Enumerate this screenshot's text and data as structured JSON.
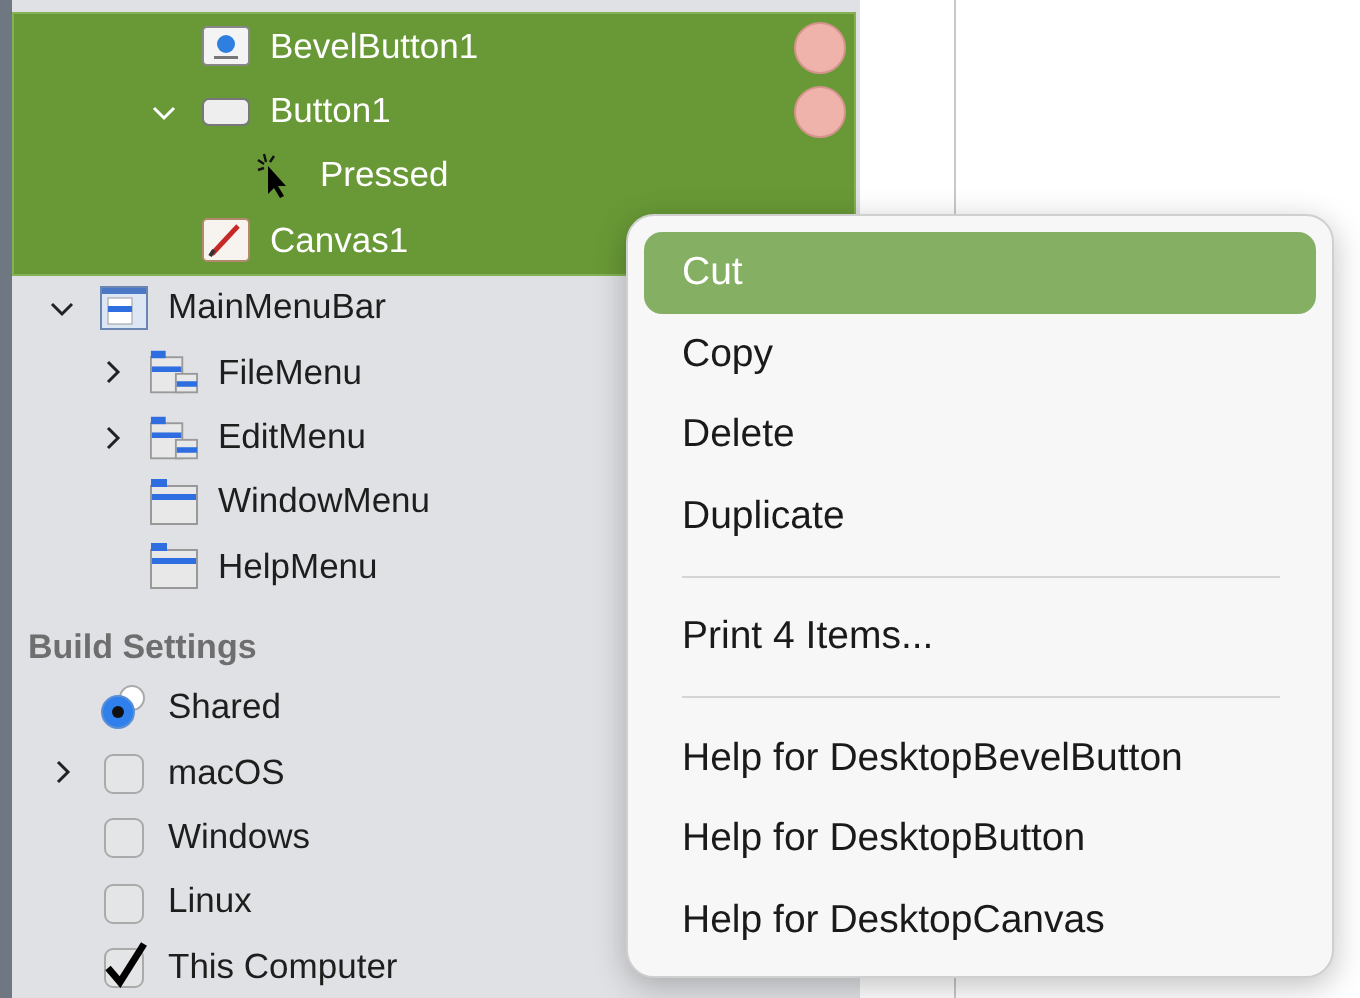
{
  "controls_tree": [
    {
      "label": "BevelButton1",
      "kind": "bevel-button",
      "selected": true,
      "marker": true
    },
    {
      "label": "Button1",
      "kind": "button",
      "selected": true,
      "marker": true,
      "expanded": true,
      "children": [
        {
          "label": "Pressed",
          "kind": "event",
          "selected": true
        }
      ]
    },
    {
      "label": "Canvas1",
      "kind": "canvas",
      "selected": true
    }
  ],
  "menu_tree": [
    {
      "label": "MainMenuBar",
      "kind": "menubar",
      "selected": false,
      "expanded": true,
      "children": [
        {
          "label": "FileMenu",
          "kind": "menu",
          "selected": false,
          "expanded": false
        },
        {
          "label": "EditMenu",
          "kind": "menu",
          "selected": false,
          "expanded": false
        },
        {
          "label": "WindowMenu",
          "kind": "menu-item",
          "selected": false
        },
        {
          "label": "HelpMenu",
          "kind": "menu-item",
          "selected": false
        }
      ]
    }
  ],
  "build_settings": {
    "title": "Build Settings",
    "items": [
      {
        "label": "Shared",
        "kind": "radio",
        "selected": true
      },
      {
        "label": "macOS",
        "kind": "checkbox",
        "checked": false,
        "expanded": false
      },
      {
        "label": "Windows",
        "kind": "checkbox",
        "checked": false
      },
      {
        "label": "Linux",
        "kind": "checkbox",
        "checked": false
      },
      {
        "label": "This Computer",
        "kind": "checkbox",
        "checked": true
      }
    ]
  },
  "context_menu": [
    {
      "kind": "item",
      "label": "Cut",
      "selected": true
    },
    {
      "kind": "item",
      "label": "Copy",
      "selected": false
    },
    {
      "kind": "item",
      "label": "Delete",
      "selected": false
    },
    {
      "kind": "item",
      "label": "Duplicate",
      "selected": false
    },
    {
      "kind": "separator"
    },
    {
      "kind": "item",
      "label": "Print 4 Items...",
      "selected": false
    },
    {
      "kind": "separator"
    },
    {
      "kind": "item",
      "label": "Help for DesktopBevelButton",
      "selected": false
    },
    {
      "kind": "item",
      "label": "Help for DesktopButton",
      "selected": false
    },
    {
      "kind": "item",
      "label": "Help for DesktopCanvas",
      "selected": false
    }
  ]
}
